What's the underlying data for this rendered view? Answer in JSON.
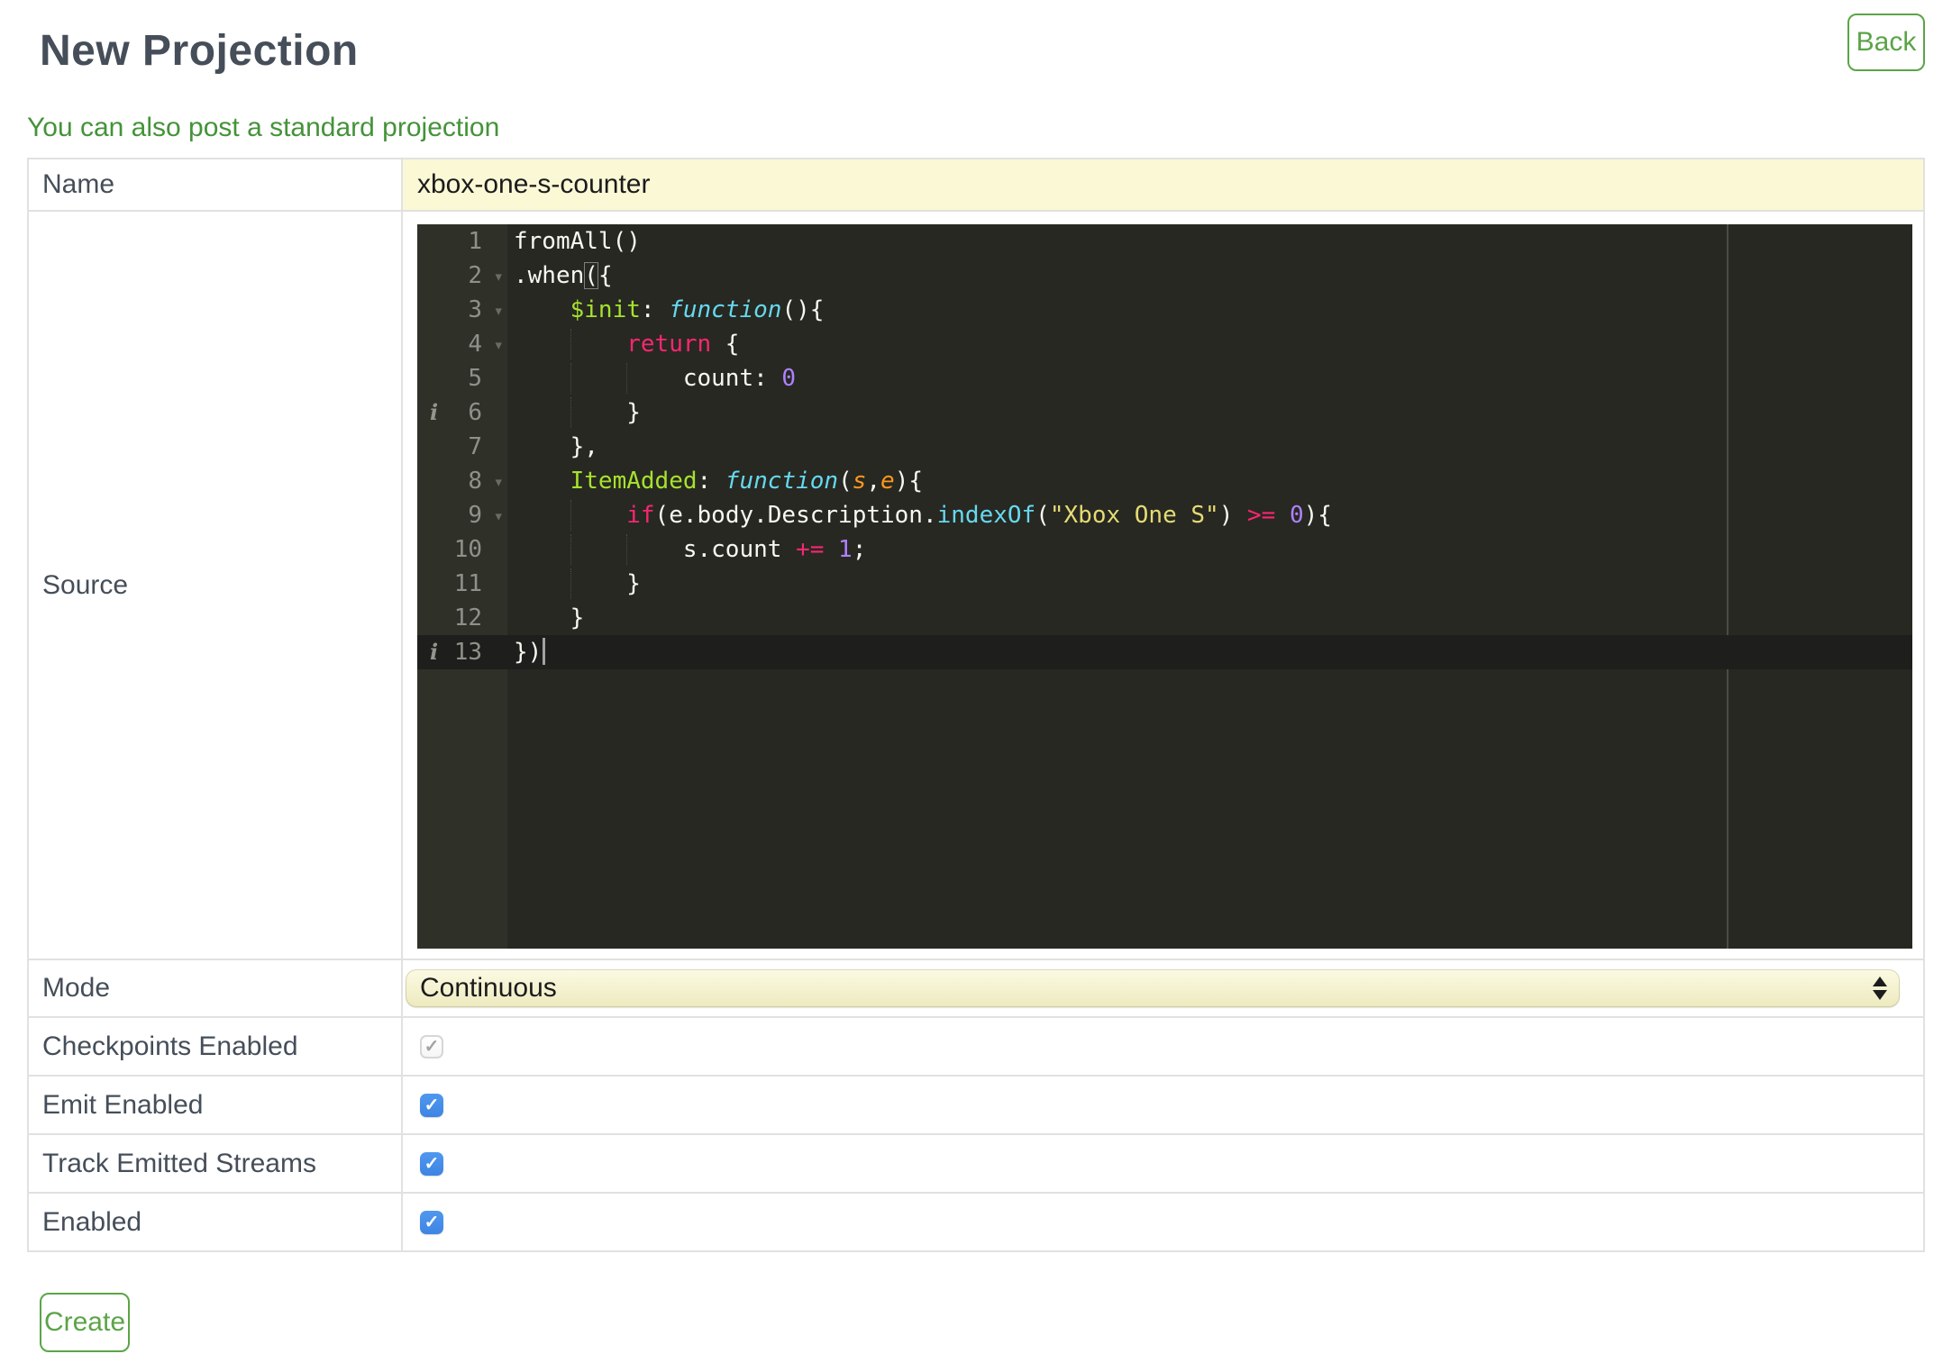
{
  "header": {
    "title": "New Projection",
    "back_label": "Back"
  },
  "link": {
    "standard_projection": "You can also post a standard projection"
  },
  "form": {
    "name": {
      "label": "Name",
      "value": "xbox-one-s-counter"
    },
    "source": {
      "label": "Source"
    },
    "mode": {
      "label": "Mode",
      "value": "Continuous"
    },
    "checkpoints": {
      "label": "Checkpoints Enabled",
      "checked": true,
      "disabled": true
    },
    "emit": {
      "label": "Emit Enabled",
      "checked": true,
      "disabled": false
    },
    "track": {
      "label": "Track Emitted Streams",
      "checked": true,
      "disabled": false
    },
    "enabled": {
      "label": "Enabled",
      "checked": true,
      "disabled": false
    }
  },
  "footer": {
    "create_label": "Create"
  },
  "icons": {
    "check": "✓",
    "fold": "▾",
    "info": "i",
    "select_stepper": "up-down-arrows"
  },
  "colors": {
    "accent_green": "#5ba447",
    "link_green": "#449339",
    "checkbox_blue": "#4690e8",
    "field_yellow": "#fbf8d6",
    "editor_background": "#272822",
    "editor_gutter": "#2f3129",
    "active_line": "#1e1f1c"
  },
  "editor": {
    "line_count": 13,
    "lines": [
      {
        "n": 1,
        "tokens": [
          [
            "d",
            "fromAll()"
          ]
        ]
      },
      {
        "n": 2,
        "fold": true,
        "tokens": [
          [
            "d",
            ".when"
          ],
          [
            "b",
            "("
          ],
          [
            "d",
            "{"
          ]
        ]
      },
      {
        "n": 3,
        "fold": true,
        "tokens": [
          [
            "d",
            "    "
          ],
          [
            "n",
            "$init"
          ],
          [
            "d",
            ": "
          ],
          [
            "f",
            "function"
          ],
          [
            "d",
            "(){"
          ]
        ]
      },
      {
        "n": 4,
        "fold": true,
        "guides": [
          4
        ],
        "tokens": [
          [
            "d",
            "        "
          ],
          [
            "k",
            "return"
          ],
          [
            "d",
            " {"
          ]
        ]
      },
      {
        "n": 5,
        "guides": [
          4,
          8
        ],
        "tokens": [
          [
            "d",
            "            count: "
          ],
          [
            "m",
            "0"
          ]
        ]
      },
      {
        "n": 6,
        "info": true,
        "guides": [
          4
        ],
        "tokens": [
          [
            "d",
            "        }"
          ]
        ]
      },
      {
        "n": 7,
        "tokens": [
          [
            "d",
            "    },"
          ]
        ]
      },
      {
        "n": 8,
        "fold": true,
        "tokens": [
          [
            "d",
            "    "
          ],
          [
            "n",
            "ItemAdded"
          ],
          [
            "d",
            ": "
          ],
          [
            "f",
            "function"
          ],
          [
            "d",
            "("
          ],
          [
            "p",
            "s"
          ],
          [
            "d",
            ","
          ],
          [
            "p",
            "e"
          ],
          [
            "d",
            "){"
          ]
        ]
      },
      {
        "n": 9,
        "fold": true,
        "guides": [
          4
        ],
        "tokens": [
          [
            "d",
            "        "
          ],
          [
            "k",
            "if"
          ],
          [
            "d",
            "(e.body.Description."
          ],
          [
            "fn",
            "indexOf"
          ],
          [
            "d",
            "("
          ],
          [
            "s",
            "\"Xbox One S\""
          ],
          [
            "d",
            ") "
          ],
          [
            "k",
            ">="
          ],
          [
            "d",
            " "
          ],
          [
            "m",
            "0"
          ],
          [
            "d",
            "){"
          ]
        ]
      },
      {
        "n": 10,
        "guides": [
          4,
          8
        ],
        "tokens": [
          [
            "d",
            "            s.count "
          ],
          [
            "k",
            "+="
          ],
          [
            "d",
            " "
          ],
          [
            "m",
            "1"
          ],
          [
            "d",
            ";"
          ]
        ]
      },
      {
        "n": 11,
        "guides": [
          4
        ],
        "tokens": [
          [
            "d",
            "        }"
          ]
        ]
      },
      {
        "n": 12,
        "tokens": [
          [
            "d",
            "    }"
          ]
        ]
      },
      {
        "n": 13,
        "info": true,
        "active": true,
        "cursor": true,
        "tokens": [
          [
            "d",
            "})"
          ]
        ]
      }
    ]
  }
}
